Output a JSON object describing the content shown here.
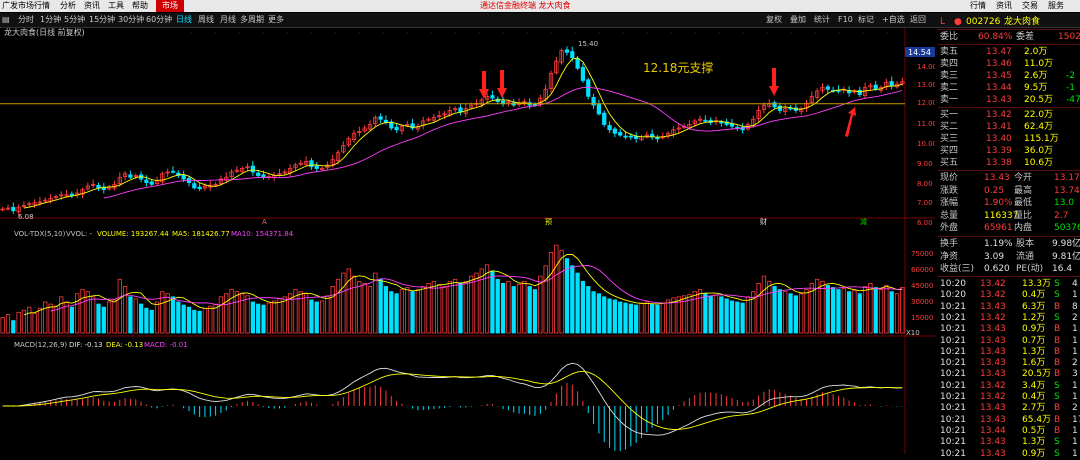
{
  "menu": {
    "title": "广发市场行情",
    "items": [
      "分析",
      "资讯",
      "工具",
      "帮助"
    ],
    "market_tab": "市场",
    "promo": "通达信金融终端  龙大肉食",
    "right": [
      "行情",
      "资讯",
      "交易",
      "服务"
    ]
  },
  "toolbar": {
    "periods": [
      "分时",
      "1分钟",
      "5分钟",
      "15分钟",
      "30分钟",
      "60分钟",
      "日线",
      "周线",
      "月线",
      "多周期",
      "更多"
    ],
    "active": "日线",
    "tools": [
      "复权",
      "叠加",
      "统计",
      "F10",
      "标记",
      "+自选",
      "返回"
    ]
  },
  "chart": {
    "title": "龙大肉食(日线 前复权)",
    "price_levels": [
      "14.00",
      "13.00",
      "12.00",
      "11.00",
      "10.00",
      "9.00",
      "8.00",
      "7.00",
      "6.00"
    ],
    "last_price_tag": "14.54",
    "high_label": "15.40",
    "low_label": "6.08",
    "support_text": "12.18元支撑",
    "support_price": 12.18,
    "vol_indicator": "VOL-TDX(5,10)",
    "vol_label": "VVOL: -",
    "vol_volume": "VOLUME: 193267.44",
    "vol_ma5": "MA5: 181426.77",
    "vol_ma10": "MA10: 154371.84",
    "vol_levels": [
      "75000",
      "60000",
      "45000",
      "30000",
      "15000"
    ],
    "vol_unit": "X10",
    "macd_indicator": "MACD(12,26,9)",
    "macd_dif": "DIF: -0.13",
    "macd_dea": "DEA: -0.13",
    "macd_val": "MACD: -0.01",
    "event_markers": [
      "A",
      "预",
      "财",
      "减"
    ]
  },
  "quote": {
    "code": "002726",
    "name": "龙大肉食",
    "wb_label": "委比",
    "wb_value": "60.84%",
    "wc_label": "委差",
    "wc_value": "1502",
    "sells": [
      {
        "label": "卖五",
        "price": "13.47",
        "vol": "2.0万"
      },
      {
        "label": "卖四",
        "price": "13.46",
        "vol": "11.0万"
      },
      {
        "label": "卖三",
        "price": "13.45",
        "vol": "2.6万",
        "chg": "-2"
      },
      {
        "label": "卖二",
        "price": "13.44",
        "vol": "9.5万",
        "chg": "-1"
      },
      {
        "label": "卖一",
        "price": "13.43",
        "vol": "20.5万",
        "chg": "-47"
      }
    ],
    "buys": [
      {
        "label": "买一",
        "price": "13.42",
        "vol": "22.0万"
      },
      {
        "label": "买二",
        "price": "13.41",
        "vol": "62.4万"
      },
      {
        "label": "买三",
        "price": "13.40",
        "vol": "115.1万"
      },
      {
        "label": "买四",
        "price": "13.39",
        "vol": "36.0万"
      },
      {
        "label": "买五",
        "price": "13.38",
        "vol": "10.6万"
      }
    ],
    "stats": [
      {
        "l1": "现价",
        "v1": "13.43",
        "l2": "今开",
        "v2": "13.17"
      },
      {
        "l1": "涨跌",
        "v1": "0.25",
        "l2": "最高",
        "v2": "13.74"
      },
      {
        "l1": "涨幅",
        "v1": "1.90%",
        "l2": "最低",
        "v2": "13.0"
      },
      {
        "l1": "总量",
        "v1": "116337",
        "l2": "量比",
        "v2": "2.7"
      },
      {
        "l1": "外盘",
        "v1": "65961",
        "l2": "内盘",
        "v2": "50376"
      }
    ],
    "stats2": [
      {
        "l1": "换手",
        "v1": "1.19%",
        "l2": "股本",
        "v2": "9.98亿"
      },
      {
        "l1": "净资",
        "v1": "3.09",
        "l2": "流通",
        "v2": "9.81亿"
      },
      {
        "l1": "收益(三)",
        "v1": "0.620",
        "l2": "PE(动)",
        "v2": "16.4"
      }
    ],
    "ticks": [
      {
        "time": "10:20",
        "price": "13.42",
        "vol": "13.3万",
        "side": "S",
        "n": "4"
      },
      {
        "time": "10:20",
        "price": "13.42",
        "vol": "0.4万",
        "side": "S",
        "n": "1"
      },
      {
        "time": "10:21",
        "price": "13.43",
        "vol": "6.3万",
        "side": "B",
        "n": "8"
      },
      {
        "time": "10:21",
        "price": "13.42",
        "vol": "1.2万",
        "side": "S",
        "n": "2"
      },
      {
        "time": "10:21",
        "price": "13.43",
        "vol": "0.9万",
        "side": "B",
        "n": "1"
      },
      {
        "time": "10:21",
        "price": "13.43",
        "vol": "0.7万",
        "side": "B",
        "n": "1"
      },
      {
        "time": "10:21",
        "price": "13.43",
        "vol": "1.3万",
        "side": "B",
        "n": "1"
      },
      {
        "time": "10:21",
        "price": "13.43",
        "vol": "1.6万",
        "side": "B",
        "n": "2"
      },
      {
        "time": "10:21",
        "price": "13.43",
        "vol": "20.5万",
        "side": "B",
        "n": "3"
      },
      {
        "time": "10:21",
        "price": "13.42",
        "vol": "3.4万",
        "side": "S",
        "n": "1"
      },
      {
        "time": "10:21",
        "price": "13.42",
        "vol": "0.4万",
        "side": "S",
        "n": "1"
      },
      {
        "time": "10:21",
        "price": "13.43",
        "vol": "2.7万",
        "side": "B",
        "n": "2"
      },
      {
        "time": "10:21",
        "price": "13.43",
        "vol": "65.4万",
        "side": "B",
        "n": "17"
      },
      {
        "time": "10:21",
        "price": "13.44",
        "vol": "0.5万",
        "side": "B",
        "n": "1"
      },
      {
        "time": "10:21",
        "price": "13.43",
        "vol": "1.3万",
        "side": "S",
        "n": "1"
      },
      {
        "time": "10:21",
        "price": "13.43",
        "vol": "0.9万",
        "side": "S",
        "n": "1"
      }
    ]
  },
  "colors": {
    "up": "#ff3b3b",
    "down": "#00e0ff",
    "ma_yellow": "#ffff00",
    "support": "#c8a000",
    "arrow": "#ff2020"
  },
  "chart_data": {
    "type": "candlestick",
    "title": "龙大肉食(日线 前复权)",
    "ylim": [
      5.8,
      15.8
    ],
    "close": [
      6.2,
      6.25,
      6.1,
      6.3,
      6.4,
      6.5,
      6.55,
      6.6,
      6.7,
      6.8,
      6.9,
      7.0,
      7.0,
      6.95,
      7.1,
      7.3,
      7.5,
      7.6,
      7.4,
      7.3,
      7.45,
      7.6,
      8.0,
      8.2,
      8.0,
      8.1,
      7.9,
      7.7,
      7.6,
      7.8,
      8.2,
      8.3,
      8.3,
      8.1,
      7.9,
      7.7,
      7.4,
      7.35,
      7.5,
      7.55,
      7.6,
      7.9,
      8.0,
      8.3,
      8.4,
      8.5,
      8.6,
      8.3,
      8.1,
      8.0,
      8.05,
      8.1,
      8.2,
      8.3,
      8.5,
      8.7,
      8.8,
      8.9,
      8.6,
      8.5,
      8.5,
      8.7,
      9.0,
      9.4,
      9.8,
      10.2,
      10.5,
      10.6,
      10.8,
      11.0,
      11.4,
      11.3,
      11.1,
      10.8,
      10.7,
      10.9,
      11.0,
      10.8,
      10.9,
      11.2,
      11.3,
      11.4,
      11.5,
      11.6,
      11.8,
      11.9,
      11.7,
      11.9,
      12.1,
      12.2,
      12.4,
      12.6,
      12.5,
      12.3,
      12.2,
      12.3,
      12.1,
      12.2,
      12.3,
      12.1,
      12.1,
      12.5,
      13.0,
      13.9,
      14.6,
      15.2,
      15.1,
      14.8,
      14.2,
      13.5,
      12.6,
      12.1,
      11.6,
      11.0,
      10.7,
      10.5,
      10.4,
      10.3,
      10.3,
      10.2,
      10.3,
      10.4,
      10.3,
      10.2,
      10.3,
      10.5,
      10.7,
      10.8,
      10.9,
      11.0,
      11.2,
      11.3,
      11.2,
      11.1,
      11.2,
      11.1,
      11.0,
      10.9,
      10.8,
      10.7,
      11.0,
      11.3,
      11.8,
      12.1,
      12.2,
      12.0,
      11.8,
      11.9,
      11.9,
      11.8,
      11.9,
      12.2,
      12.6,
      12.9,
      13.1,
      13.0,
      12.9,
      12.9,
      13.0,
      12.8,
      12.9,
      12.7,
      13.1,
      13.2,
      13.0,
      13.1,
      13.4,
      13.2,
      13.3,
      13.43
    ],
    "volume": [
      15000,
      18000,
      12000,
      20000,
      22000,
      25000,
      19000,
      24000,
      30000,
      28000,
      26000,
      35000,
      30000,
      25000,
      38000,
      42000,
      40000,
      35000,
      28000,
      25000,
      30000,
      32000,
      52000,
      45000,
      35000,
      33000,
      28000,
      24000,
      22000,
      30000,
      40000,
      38000,
      35000,
      30000,
      27000,
      25000,
      22000,
      21000,
      24000,
      26000,
      28000,
      35000,
      38000,
      42000,
      40000,
      38000,
      36000,
      30000,
      28000,
      27000,
      29000,
      31000,
      33000,
      35000,
      38000,
      42000,
      40000,
      38000,
      32000,
      30000,
      31000,
      36000,
      45000,
      52000,
      58000,
      62000,
      55000,
      50000,
      48000,
      45000,
      58000,
      52000,
      45000,
      40000,
      38000,
      42000,
      44000,
      40000,
      42000,
      45000,
      48000,
      50000,
      47000,
      45000,
      50000,
      52000,
      48000,
      50000,
      55000,
      58000,
      62000,
      66000,
      60000,
      52000,
      48000,
      50000,
      45000,
      47000,
      50000,
      45000,
      42000,
      55000,
      65000,
      78000,
      85000,
      80000,
      72000,
      65000,
      58000,
      50000,
      45000,
      40000,
      38000,
      35000,
      33000,
      32000,
      30000,
      29000,
      28000,
      27000,
      29000,
      30000,
      28000,
      27000,
      29000,
      32000,
      34000,
      35000,
      36000,
      37000,
      40000,
      42000,
      38000,
      36000,
      37000,
      35000,
      33000,
      31000,
      30000,
      29000,
      35000,
      40000,
      48000,
      55000,
      50000,
      45000,
      42000,
      40000,
      38000,
      36000,
      38000,
      42000,
      48000,
      52000,
      50000,
      46000,
      44000,
      42000,
      43000,
      40000,
      41000,
      38000,
      45000,
      48000,
      44000,
      42000,
      46000,
      40000,
      38000,
      44000
    ]
  }
}
